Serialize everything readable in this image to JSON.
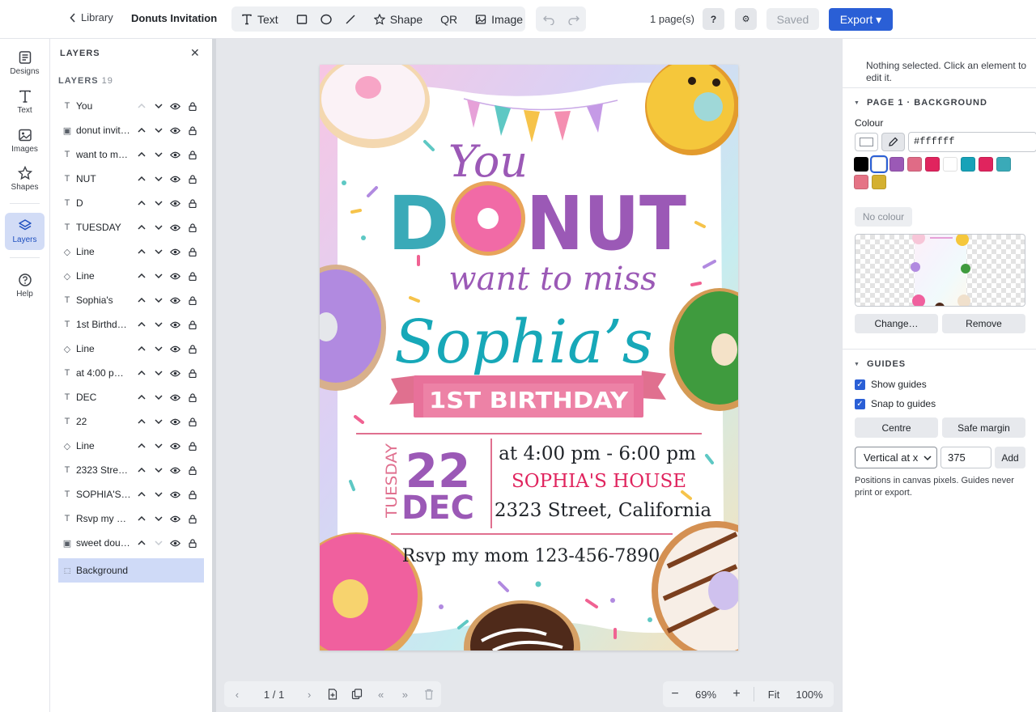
{
  "topbar": {
    "back_label": "Library",
    "doc_title": "Donuts Invitation",
    "tools": [
      {
        "label": "Text",
        "icon": "text-icon"
      },
      {
        "label": "",
        "icon": "rectangle-icon"
      },
      {
        "label": "",
        "icon": "ellipse-icon"
      },
      {
        "label": "",
        "icon": "line-icon"
      },
      {
        "label": "Shape",
        "icon": "star-icon"
      },
      {
        "label": "QR",
        "icon": "qr-icon"
      },
      {
        "label": "Image",
        "icon": "image-icon"
      }
    ],
    "pages_label": "1 page(s)",
    "help_label": "?",
    "settings_label": "⚙",
    "saved_label": "Saved",
    "export_label": "Export ▾"
  },
  "rail": {
    "items": [
      {
        "label": "Designs",
        "icon": "designs-icon",
        "active": false
      },
      {
        "label": "Text",
        "icon": "text-icon",
        "active": false
      },
      {
        "label": "Images",
        "icon": "images-icon",
        "active": false
      },
      {
        "label": "Shapes",
        "icon": "shapes-icon",
        "active": false
      },
      {
        "label": "Layers",
        "icon": "layers-icon",
        "active": true
      },
      {
        "label": "Help",
        "icon": "help-icon",
        "active": false
      }
    ]
  },
  "layers": {
    "title": "LAYERS",
    "count_label": "LAYERS",
    "count": "19",
    "items": [
      {
        "type": "T",
        "name": "You"
      },
      {
        "type": "img",
        "name": "donut invit…"
      },
      {
        "type": "T",
        "name": "want to m…"
      },
      {
        "type": "T",
        "name": "NUT"
      },
      {
        "type": "T",
        "name": "D"
      },
      {
        "type": "T",
        "name": "TUESDAY"
      },
      {
        "type": "line",
        "name": "Line"
      },
      {
        "type": "line",
        "name": "Line"
      },
      {
        "type": "T",
        "name": "Sophia's"
      },
      {
        "type": "T",
        "name": "1st Birthd…"
      },
      {
        "type": "line",
        "name": "Line"
      },
      {
        "type": "T",
        "name": "at 4:00 pm…"
      },
      {
        "type": "T",
        "name": "DEC"
      },
      {
        "type": "T",
        "name": "22"
      },
      {
        "type": "line",
        "name": "Line"
      },
      {
        "type": "T",
        "name": "2323 Stre…"
      },
      {
        "type": "T",
        "name": "SOPHIA'S …"
      },
      {
        "type": "T",
        "name": "Rsvp my m…"
      },
      {
        "type": "img",
        "name": "sweet dou…"
      }
    ],
    "selected": "Background"
  },
  "invitation": {
    "you": "You",
    "donut_d": "D",
    "donut_nut": "NUT",
    "want_to_miss": "want to miss",
    "name": "Sophia’s",
    "birthday": "1ST BIRTHDAY",
    "weekday": "TUESDAY",
    "day": "22",
    "month": "DEC",
    "time": "at 4:00 pm - 6:00 pm",
    "venue": "SOPHIA'S HOUSE",
    "address": "2323 Street, California",
    "rsvp": "Rsvp my mom 123-456-7890"
  },
  "bottombar": {
    "page_indicator": "1 / 1",
    "zoom": "69%",
    "fit": "Fit",
    "actual": "100%"
  },
  "inspector": {
    "note": "Nothing selected. Click an element to edit it.",
    "background_section": "PAGE 1 · BACKGROUND",
    "colour_label": "Colour",
    "hex": "#ffffff",
    "palette": [
      "#000000",
      "#ffffff",
      "#9b59b6",
      "#e06b86",
      "#e0245e",
      "#ffffff",
      "#17a2b8",
      "#e0245e",
      "#3aaab8",
      "#e57385",
      "#d4b030"
    ],
    "no_colour": "No colour",
    "change": "Change…",
    "remove": "Remove",
    "guides_section": "GUIDES",
    "show_guides": "Show guides",
    "snap_guides": "Snap to guides",
    "centre": "Centre",
    "safe_margin": "Safe margin",
    "orientation": "Vertical at x",
    "position": "375",
    "add": "Add",
    "help": "Positions in canvas pixels. Guides never print or export."
  },
  "colors": {
    "accent": "#2a5fd6",
    "purple": "#9b59b6",
    "teal": "#17a8b8",
    "pink": "#e0245e",
    "yellow": "#d9b22e",
    "ribbon": "#e8719a"
  }
}
